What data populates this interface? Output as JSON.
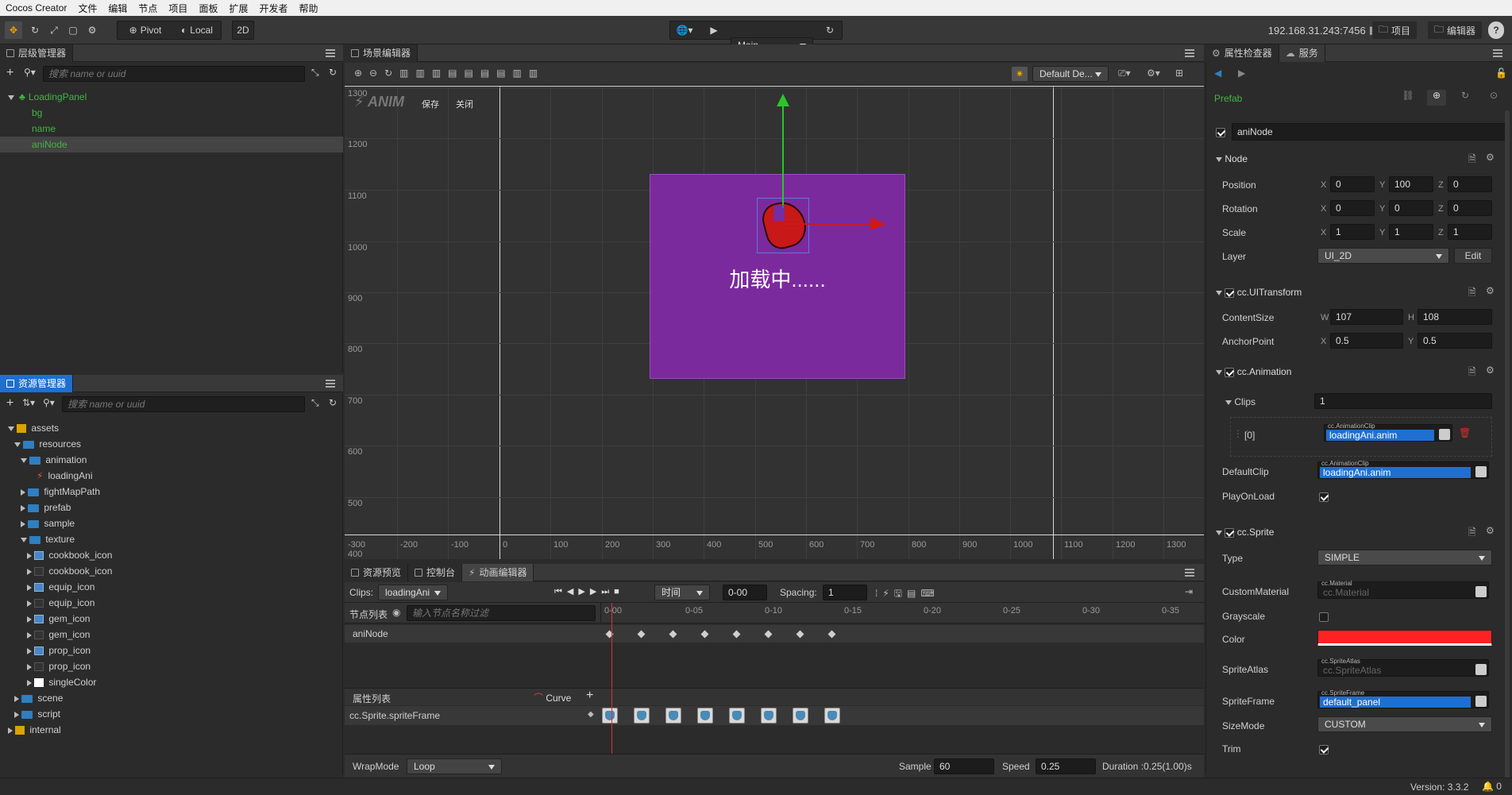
{
  "menubar": [
    "Cocos Creator",
    "文件",
    "编辑",
    "节点",
    "项目",
    "面板",
    "扩展",
    "开发者",
    "帮助"
  ],
  "toolbar": {
    "pivot": "Pivot",
    "local": "Local",
    "mode2d": "2D",
    "scene_select": "Main",
    "ip": "192.168.31.243:7456",
    "project": "项目",
    "editor": "编辑器",
    "help": "?"
  },
  "hierarchy": {
    "title": "层级管理器",
    "search_placeholder": "搜索 name or uuid",
    "nodes": [
      "LoadingPanel",
      "bg",
      "name",
      "aniNode"
    ]
  },
  "assets": {
    "title": "资源管理器",
    "search_placeholder": "搜索 name or uuid",
    "items": [
      "assets",
      "resources",
      "animation",
      "loadingAni",
      "fightMapPath",
      "prefab",
      "sample",
      "texture",
      "cookbook_icon",
      "cookbook_icon",
      "equip_icon",
      "equip_icon",
      "gem_icon",
      "gem_icon",
      "prop_icon",
      "prop_icon",
      "singleColor",
      "scene",
      "script",
      "internal"
    ]
  },
  "scene": {
    "title": "场景编辑器",
    "anim_label": "ANIM",
    "save": "保存",
    "close": "关闭",
    "camera_select": "Default De...",
    "loading_text": "加载中......",
    "y_ticks": [
      "1300",
      "1200",
      "1100",
      "1000",
      "900",
      "800",
      "700",
      "600",
      "500",
      "400"
    ],
    "x_ticks": [
      "-300",
      "-200",
      "-100",
      "0",
      "100",
      "200",
      "300",
      "400",
      "500",
      "600",
      "700",
      "800",
      "900",
      "1000",
      "1100",
      "1200",
      "1300"
    ]
  },
  "bottom": {
    "tabs": [
      "资源预览",
      "控制台",
      "动画编辑器"
    ],
    "clips_label": "Clips:",
    "clip_value": "loadingAni",
    "time_mode": "时间",
    "time_value": "0-00",
    "spacing_label": "Spacing:",
    "spacing_value": "1",
    "node_list": "节点列表",
    "node_filter_placeholder": "输入节点名称过滤",
    "node_name": "aniNode",
    "time_ticks": [
      "0-00",
      "0-05",
      "0-10",
      "0-15",
      "0-20",
      "0-25",
      "0-30",
      "0-35"
    ],
    "prop_list": "属性列表",
    "curve": "Curve",
    "prop_name": "cc.Sprite.spriteFrame",
    "wrapmode_label": "WrapMode",
    "wrapmode_value": "Loop",
    "sample_label": "Sample",
    "sample_value": "60",
    "speed_label": "Speed",
    "speed_value": "0.25",
    "duration": "Duration :0.25(1.00)s"
  },
  "inspector": {
    "tabs": [
      "属性检查器",
      "服务"
    ],
    "prefab": "Prefab",
    "node_name": "aniNode",
    "node_section": "Node",
    "position": {
      "label": "Position",
      "x": "0",
      "y": "100",
      "z": "0"
    },
    "rotation": {
      "label": "Rotation",
      "x": "0",
      "y": "0",
      "z": "0"
    },
    "scale": {
      "label": "Scale",
      "x": "1",
      "y": "1",
      "z": "1"
    },
    "layer": {
      "label": "Layer",
      "value": "UI_2D",
      "edit": "Edit"
    },
    "uitransform": {
      "title": "cc.UITransform",
      "content_size": "ContentSize",
      "w": "107",
      "h": "108",
      "anchor": "AnchorPoint",
      "ax": "0.5",
      "ay": "0.5"
    },
    "animation": {
      "title": "cc.Animation",
      "clips": "Clips",
      "clips_count": "1",
      "index": "[0]",
      "clip_tag": "cc.AnimationClip",
      "clip_value": "loadingAni.anim",
      "default_clip": "DefaultClip",
      "play_on_load": "PlayOnLoad"
    },
    "sprite": {
      "title": "cc.Sprite",
      "type": "Type",
      "type_value": "SIMPLE",
      "custom_material": "CustomMaterial",
      "material_tag": "cc.Material",
      "material_value": "cc.Material",
      "grayscale": "Grayscale",
      "color": "Color",
      "color_hex": "#ff2222",
      "sprite_atlas": "SpriteAtlas",
      "atlas_tag": "cc.SpriteAtlas",
      "atlas_value": "cc.SpriteAtlas",
      "sprite_frame": "SpriteFrame",
      "frame_tag": "cc.SpriteFrame",
      "frame_value": "default_panel",
      "size_mode": "SizeMode",
      "size_mode_value": "CUSTOM",
      "trim": "Trim"
    }
  },
  "status": {
    "version": "Version: 3.3.2",
    "notifications": "0"
  }
}
